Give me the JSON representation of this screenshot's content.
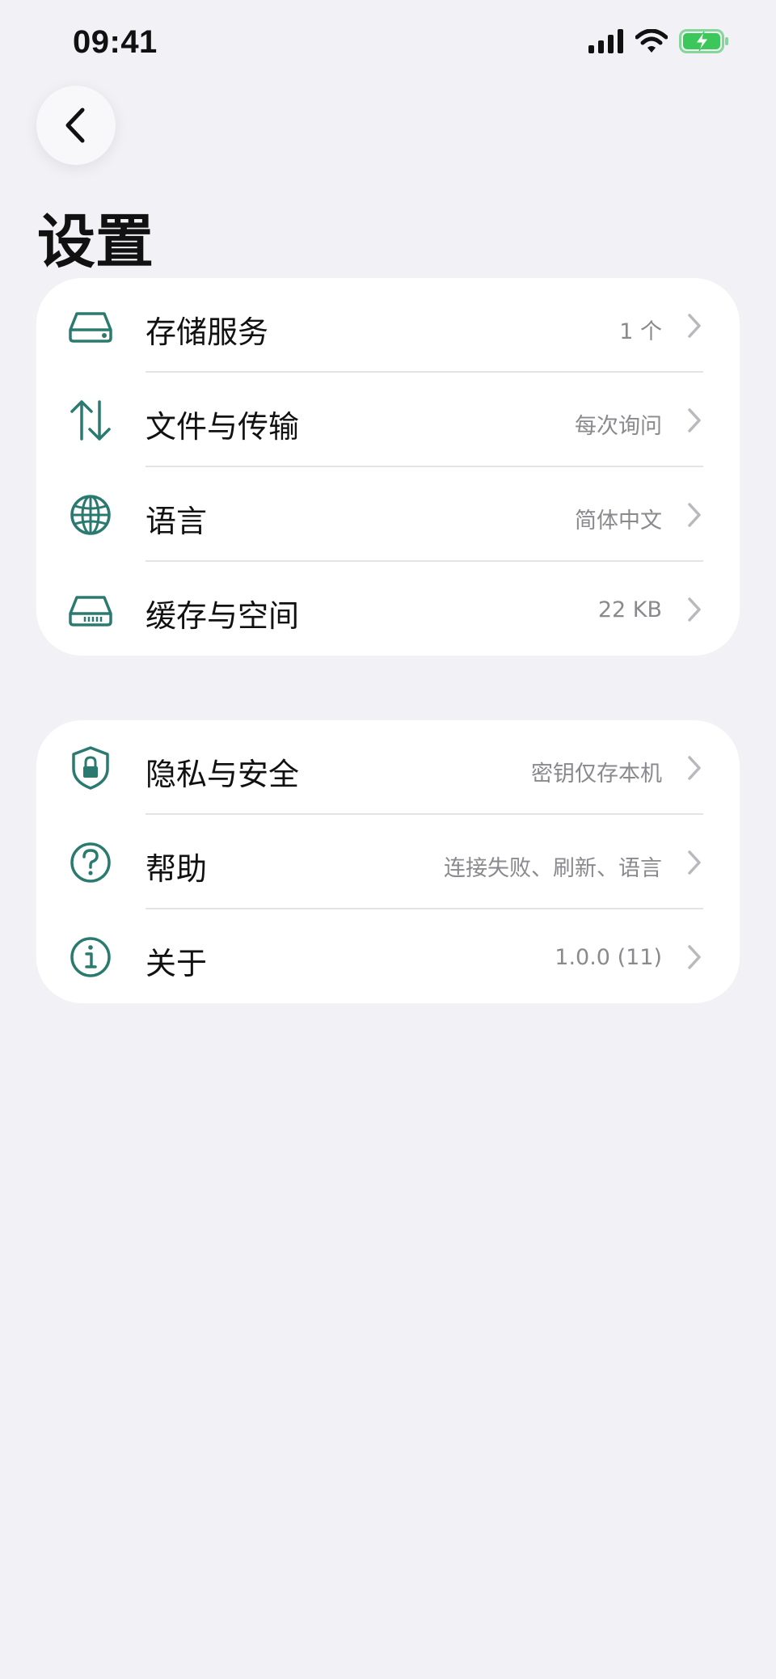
{
  "status_bar": {
    "time": "09:41"
  },
  "header": {
    "title": "设置"
  },
  "colors": {
    "accent": "#2b7a70",
    "background": "#f1f1f6",
    "battery": "#3cc75a"
  },
  "groups": [
    {
      "items": [
        {
          "label": "存储服务",
          "value": "1 个",
          "icon": "storage-drive-icon"
        },
        {
          "label": "文件与传输",
          "value": "每次询问",
          "icon": "transfer-arrows-icon"
        },
        {
          "label": "语言",
          "value": "简体中文",
          "icon": "globe-icon"
        },
        {
          "label": "缓存与空间",
          "value": "22 KB",
          "icon": "cache-drive-icon"
        }
      ]
    },
    {
      "items": [
        {
          "label": "隐私与安全",
          "value": "密钥仅存本机",
          "icon": "shield-lock-icon"
        },
        {
          "label": "帮助",
          "value": "连接失败、刷新、语言",
          "icon": "question-icon"
        },
        {
          "label": "关于",
          "value": "1.0.0 (11)",
          "icon": "info-icon"
        }
      ]
    }
  ]
}
